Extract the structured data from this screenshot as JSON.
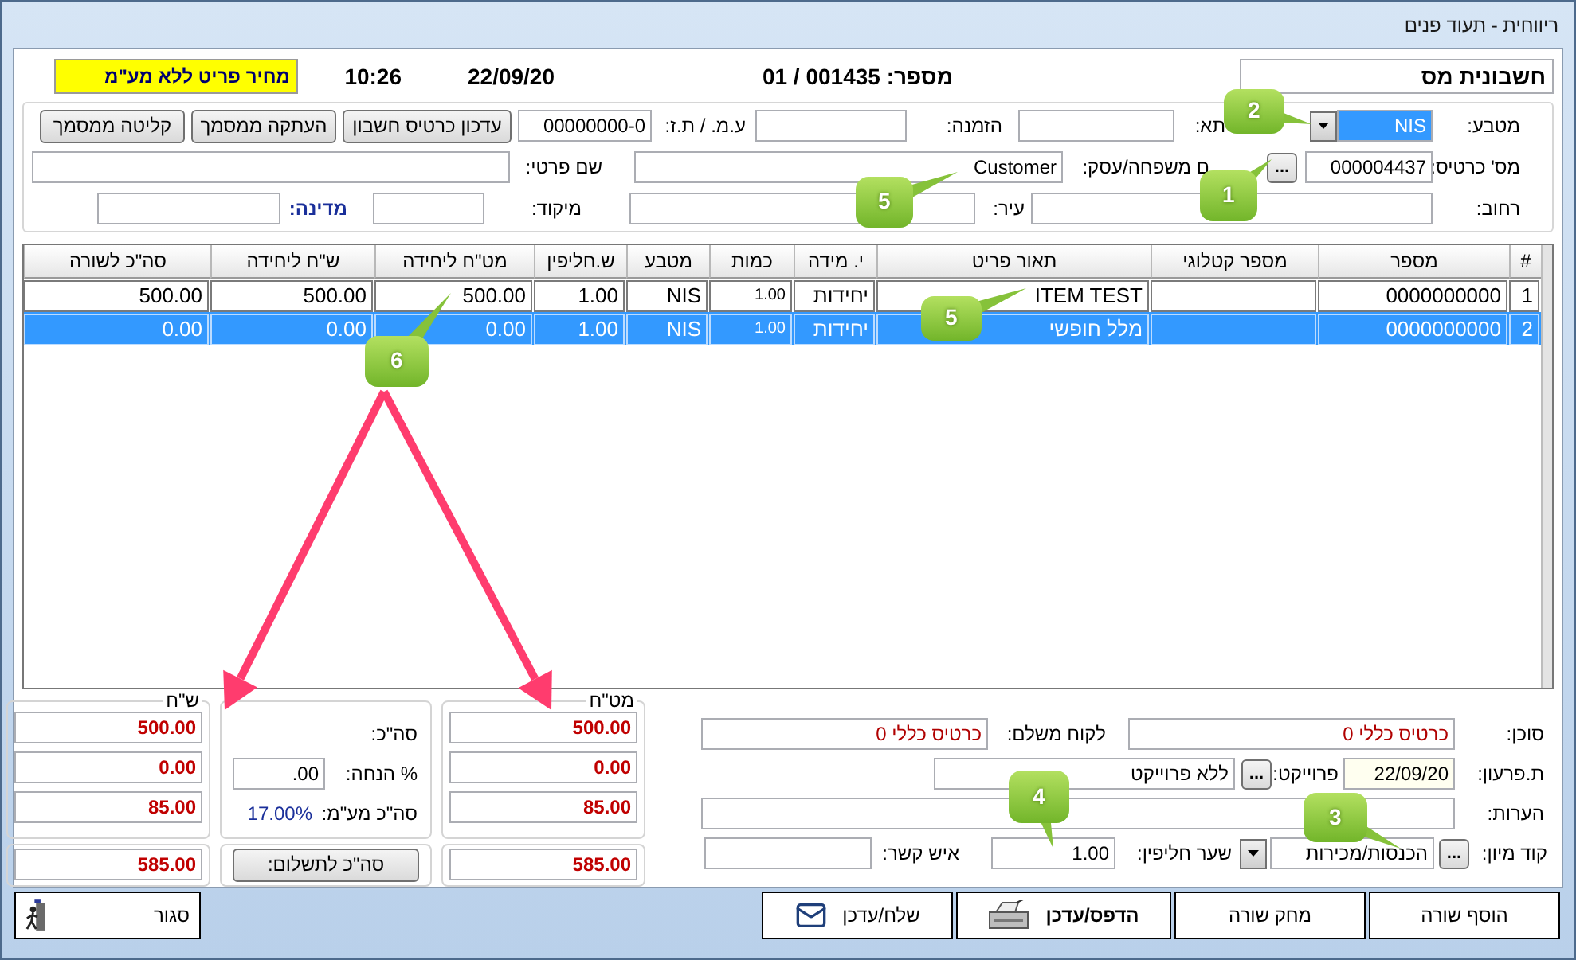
{
  "window": {
    "title": "ריווחית - תעוד פנים"
  },
  "header": {
    "document_type": "חשבונית מס",
    "number": "מספר: 001435 / 01",
    "date": "22/09/20",
    "time": "10:26",
    "price_note": "מחיר פריט ללא מע\"מ"
  },
  "customer": {
    "currency_label": "מטבע:",
    "currency": {
      "value": "NIS",
      "focused": true
    },
    "covered_label": "תא:",
    "order_label": "הזמנה:",
    "tax_id_label": "ע.מ. / ת.ז:",
    "tax_id": "00000000-0",
    "actions": [
      "עדכון כרטיס חשבון",
      "העתקה ממסמך",
      "קליטה ממסמך"
    ],
    "card_label": "מס' כרטיס:",
    "card_number": "000004437",
    "card_browse": "...",
    "last_name_label": "ם משפחה/עסק:",
    "last_name": "Customer",
    "first_name_label": "שם פרטי:",
    "street_label": "רחוב:",
    "city_label": "עיר:",
    "zip_label": "מיקוד:",
    "country_label": "מדינה:"
  },
  "table": {
    "columns": [
      "#",
      "מספר",
      "מספר קטלוגי",
      "תאור פריט",
      "י. מידה",
      "כמות",
      "מטבע",
      "ש.חליפין",
      "מט\"ח ליחידה",
      "ש\"ח ליחידה",
      "סה\"כ לשורה"
    ],
    "rows": [
      {
        "selected": false,
        "cells": [
          "1",
          "0000000000",
          "",
          "ITEM TEST",
          "יחידות",
          "1.00",
          "NIS",
          "1.00",
          "500.00",
          "500.00",
          "500.00"
        ]
      },
      {
        "selected": true,
        "cells": [
          "2",
          "0000000000",
          "",
          "מלל חופשי",
          "יחידות",
          "1.00",
          "NIS",
          "1.00",
          "0.00",
          "0.00",
          "0.00"
        ]
      }
    ]
  },
  "totals": {
    "foreign": {
      "legend": "מט\"ח",
      "values": [
        "500.00",
        "0.00",
        "85.00"
      ],
      "total": "585.00"
    },
    "summary": {
      "total_label": "סה\"כ:",
      "discount_label": "% הנחה:",
      "discount": ".00",
      "vat_label": "סה\"כ מע\"מ:",
      "vat_rate": "17.00%",
      "pay_button": "סה\"כ לתשלום:"
    },
    "local": {
      "legend": "ש\"ח",
      "values": [
        "500.00",
        "0.00",
        "85.00"
      ],
      "total": "585.00"
    }
  },
  "details": {
    "agent_label": "סוכן:",
    "agent": "כרטיס כללי 0",
    "payer_label": "לקוח משלם:",
    "payer": "כרטיס כללי 0",
    "due_label": "ת.פרעון:",
    "due_date": "22/09/20",
    "project_label": "פרוייקט:",
    "project_browse": "...",
    "project": "ללא פרוייקט",
    "notes_label": "הערות:",
    "sort_label": "קוד מיון:",
    "sort_browse": "...",
    "sort_code": "הכנסות/מכירות",
    "rate_label": "שער חליפין:",
    "rate": "1.00",
    "contact_label": "איש קשר:"
  },
  "buttons": [
    {
      "label": "הוסף שורה",
      "kind": "plain"
    },
    {
      "label": "מחק שורה",
      "kind": "plain"
    },
    {
      "label": "הדפס/עדכן",
      "kind": "print"
    },
    {
      "label": "שלח/עדכן",
      "kind": "send"
    }
  ],
  "close_button": {
    "label": "סגור"
  },
  "callouts": [
    {
      "label": "2"
    },
    {
      "label": "1"
    },
    {
      "label": "5"
    },
    {
      "label": "5"
    },
    {
      "label": "6"
    },
    {
      "label": "4"
    },
    {
      "label": "3"
    }
  ]
}
